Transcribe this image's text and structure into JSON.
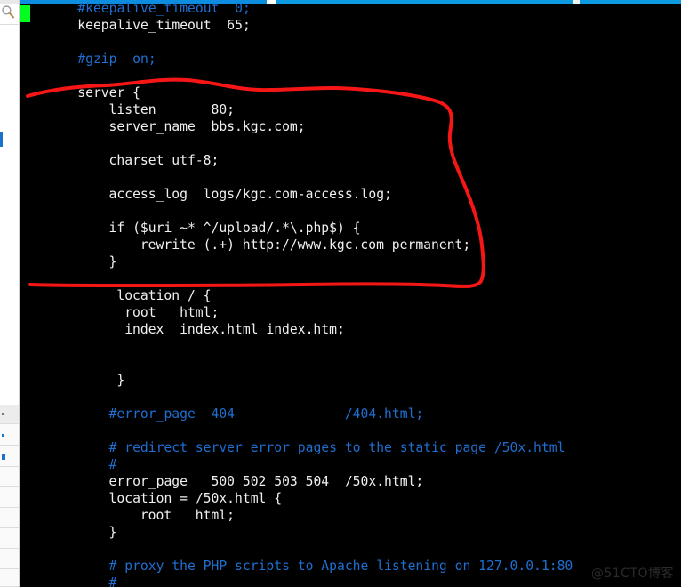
{
  "window": {
    "app_kind": "terminal-text-editor",
    "accent_color": "#0c9ae0",
    "background_color": "#000000",
    "text_color": "#f0f0f0",
    "comment_color": "#1f6fd0",
    "cursor_color": "#00ff1e"
  },
  "left_chrome": {
    "search_icon": "search-icon"
  },
  "editor": {
    "language": "nginx-conf",
    "lines": [
      {
        "indent": 4,
        "segments": [
          {
            "text": "#keepalive_timeout  0;",
            "kind": "comment"
          }
        ]
      },
      {
        "indent": 4,
        "segments": [
          {
            "text": "keepalive_timeout  65;",
            "kind": "text"
          }
        ]
      },
      {
        "indent": 0,
        "segments": [
          {
            "text": "",
            "kind": "text"
          }
        ]
      },
      {
        "indent": 4,
        "segments": [
          {
            "text": "#gzip  on;",
            "kind": "comment"
          }
        ]
      },
      {
        "indent": 0,
        "segments": [
          {
            "text": "",
            "kind": "text"
          }
        ]
      },
      {
        "indent": 4,
        "segments": [
          {
            "text": "server {",
            "kind": "text"
          }
        ]
      },
      {
        "indent": 8,
        "segments": [
          {
            "text": "listen       80;",
            "kind": "text"
          }
        ]
      },
      {
        "indent": 8,
        "segments": [
          {
            "text": "server_name  bbs.kgc.com;",
            "kind": "text"
          }
        ]
      },
      {
        "indent": 0,
        "segments": [
          {
            "text": "",
            "kind": "text"
          }
        ]
      },
      {
        "indent": 8,
        "segments": [
          {
            "text": "charset utf-8;",
            "kind": "text"
          }
        ]
      },
      {
        "indent": 0,
        "segments": [
          {
            "text": "",
            "kind": "text"
          }
        ]
      },
      {
        "indent": 8,
        "segments": [
          {
            "text": "access_log  logs/kgc.com-access.log;",
            "kind": "text"
          }
        ]
      },
      {
        "indent": 0,
        "segments": [
          {
            "text": "",
            "kind": "text"
          }
        ]
      },
      {
        "indent": 8,
        "segments": [
          {
            "text": "if ($uri ~* ^/upload/.*\\.php$) {",
            "kind": "text"
          }
        ]
      },
      {
        "indent": 12,
        "segments": [
          {
            "text": "rewrite (.+) http://www.kgc.com permanent;",
            "kind": "text"
          }
        ]
      },
      {
        "indent": 8,
        "segments": [
          {
            "text": "}",
            "kind": "text"
          }
        ]
      },
      {
        "indent": 0,
        "segments": [
          {
            "text": "",
            "kind": "text"
          }
        ]
      },
      {
        "indent": 9,
        "segments": [
          {
            "text": "location / {",
            "kind": "text"
          }
        ]
      },
      {
        "indent": 10,
        "segments": [
          {
            "text": "root   html;",
            "kind": "text"
          }
        ]
      },
      {
        "indent": 10,
        "segments": [
          {
            "text": "index  index.html index.htm;",
            "kind": "text"
          }
        ]
      },
      {
        "indent": 0,
        "segments": [
          {
            "text": "",
            "kind": "text"
          }
        ]
      },
      {
        "indent": 0,
        "segments": [
          {
            "text": "",
            "kind": "text"
          }
        ]
      },
      {
        "indent": 9,
        "segments": [
          {
            "text": "}",
            "kind": "text"
          }
        ]
      },
      {
        "indent": 0,
        "segments": [
          {
            "text": "",
            "kind": "text"
          }
        ]
      },
      {
        "indent": 8,
        "segments": [
          {
            "text": "#error_page  404              /404.html;",
            "kind": "comment"
          }
        ]
      },
      {
        "indent": 0,
        "segments": [
          {
            "text": "",
            "kind": "text"
          }
        ]
      },
      {
        "indent": 8,
        "segments": [
          {
            "text": "# redirect server error pages to the static page /50x.html",
            "kind": "comment"
          }
        ]
      },
      {
        "indent": 8,
        "segments": [
          {
            "text": "#",
            "kind": "comment"
          }
        ]
      },
      {
        "indent": 8,
        "segments": [
          {
            "text": "error_page   500 502 503 504  /50x.html;",
            "kind": "text"
          }
        ]
      },
      {
        "indent": 8,
        "segments": [
          {
            "text": "location = /50x.html {",
            "kind": "text"
          }
        ]
      },
      {
        "indent": 12,
        "segments": [
          {
            "text": "root   html;",
            "kind": "text"
          }
        ]
      },
      {
        "indent": 8,
        "segments": [
          {
            "text": "}",
            "kind": "text"
          }
        ]
      },
      {
        "indent": 0,
        "segments": [
          {
            "text": "",
            "kind": "text"
          }
        ]
      },
      {
        "indent": 8,
        "segments": [
          {
            "text": "# proxy the PHP scripts to Apache listening on 127.0.0.1:80",
            "kind": "comment"
          }
        ]
      },
      {
        "indent": 8,
        "segments": [
          {
            "text": "#",
            "kind": "comment"
          }
        ]
      }
    ]
  },
  "annotation": {
    "kind": "hand-drawn-highlight-loop",
    "color": "#f71616",
    "stroke_width": 4,
    "encloses_lines": "server { ... }"
  },
  "watermark": {
    "text": "@51CTO博客"
  }
}
